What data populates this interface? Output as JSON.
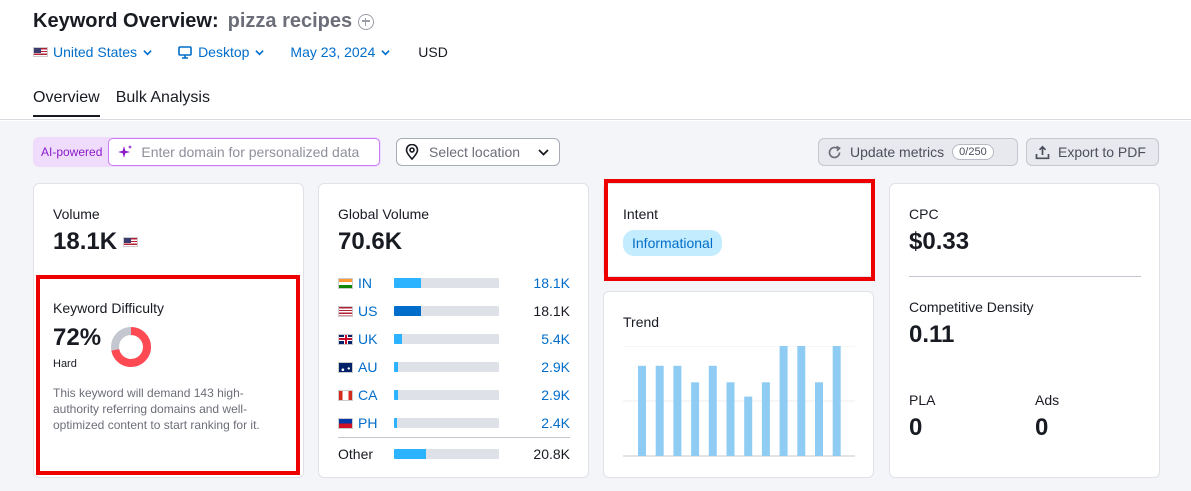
{
  "header": {
    "title": "Keyword Overview:",
    "keyword": "pizza recipes",
    "filters": {
      "country": "United States",
      "device": "Desktop",
      "date": "May 23, 2024",
      "currency": "USD"
    },
    "tabs": [
      "Overview",
      "Bulk Analysis"
    ]
  },
  "toolbar": {
    "ai_label": "AI-powered",
    "domain_placeholder": "Enter domain for personalized data",
    "location_placeholder": "Select location",
    "update_label": "Update metrics",
    "update_count": "0/250",
    "export_label": "Export to PDF"
  },
  "volume": {
    "label": "Volume",
    "value": "18.1K",
    "kd_label": "Keyword Difficulty",
    "kd_value": "72%",
    "kd_percent": 72,
    "kd_level": "Hard",
    "kd_description": "This keyword will demand 143 high-authority referring domains and well-optimized content to start ranking for it."
  },
  "global_volume": {
    "label": "Global Volume",
    "value": "70.6K",
    "rows": [
      {
        "code": "IN",
        "value": "18.1K",
        "share": 0.26
      },
      {
        "code": "US",
        "value": "18.1K",
        "share": 0.26
      },
      {
        "code": "UK",
        "value": "5.4K",
        "share": 0.08
      },
      {
        "code": "AU",
        "value": "2.9K",
        "share": 0.04
      },
      {
        "code": "CA",
        "value": "2.9K",
        "share": 0.04
      },
      {
        "code": "PH",
        "value": "2.4K",
        "share": 0.03
      }
    ],
    "other_label": "Other",
    "other_value": "20.8K",
    "other_share": 0.3
  },
  "intent": {
    "label": "Intent",
    "badge": "Informational"
  },
  "trend": {
    "label": "Trend",
    "values": [
      0.82,
      0.82,
      0.82,
      0.67,
      0.82,
      0.67,
      0.54,
      0.67,
      1.0,
      1.0,
      0.67,
      1.0
    ]
  },
  "cpc": {
    "label": "CPC",
    "value": "$0.33",
    "cd_label": "Competitive Density",
    "cd_value": "0.11",
    "pla_label": "PLA",
    "pla_value": "0",
    "ads_label": "Ads",
    "ads_value": "0"
  },
  "colors": {
    "link": "#006dca",
    "kd_hard": "#ff4953",
    "bar_light": "#2bb3ff",
    "trend_bar": "#8fccf4",
    "highlight": "#ee0000"
  }
}
